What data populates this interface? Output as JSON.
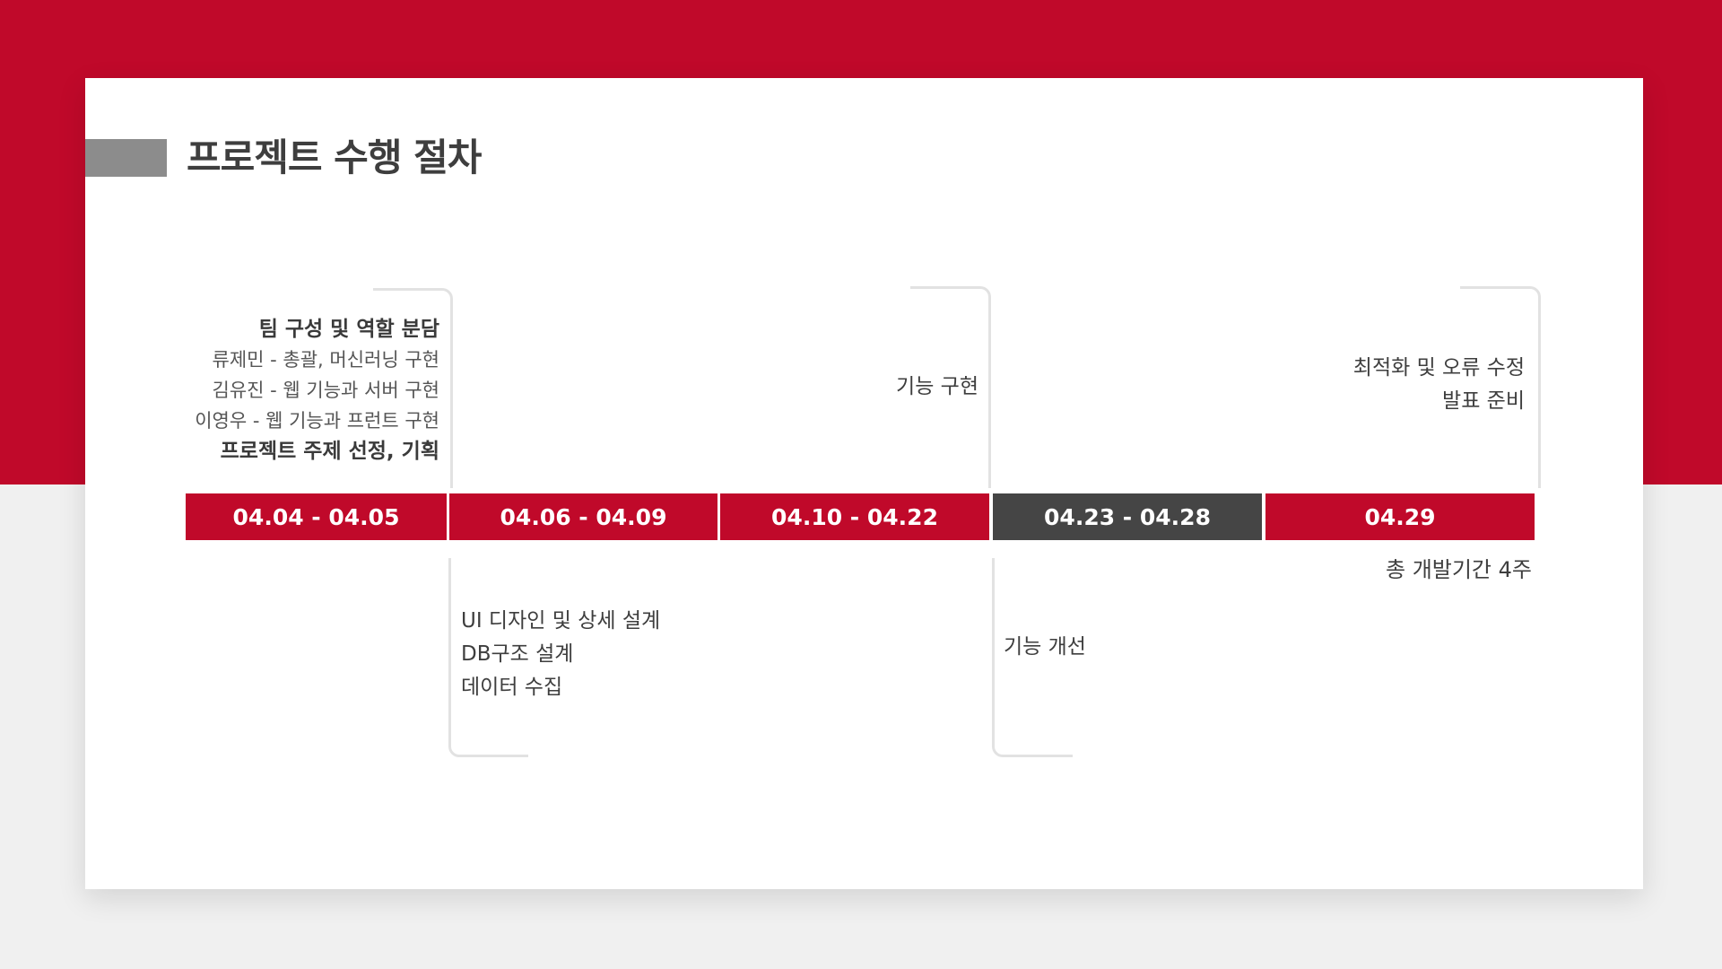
{
  "slide": {
    "title": "프로젝트 수행 절차"
  },
  "timeline": {
    "segments": [
      {
        "label": "04.04 - 04.05",
        "color": "#c0092a"
      },
      {
        "label": "04.06 - 04.09",
        "color": "#c0092a"
      },
      {
        "label": "04.10 - 04.22",
        "color": "#c0092a"
      },
      {
        "label": "04.23 - 04.28",
        "color": "#454545"
      },
      {
        "label": "04.29",
        "color": "#c0092a"
      }
    ]
  },
  "phase1": {
    "lines": [
      "팀 구성 및 역할 분담",
      "류제민 - 총괄, 머신러닝 구현",
      "김유진 - 웹 기능과 서버 구현",
      "이영우 - 웹 기능과 프런트 구현",
      "프로젝트 주제 선정, 기획"
    ]
  },
  "phase2": {
    "lines": [
      "UI 디자인 및 상세 설계",
      "DB구조 설계",
      "데이터 수집"
    ]
  },
  "phase3": {
    "lines": [
      "기능 구현"
    ]
  },
  "phase4": {
    "lines": [
      "기능 개선"
    ]
  },
  "phase5": {
    "lines": [
      "최적화 및 오류 수정",
      "발표 준비"
    ]
  },
  "footer": {
    "total": "총 개발기간 4주"
  },
  "colors": {
    "accent": "#c0092a",
    "dark": "#454545",
    "title_bar": "#8c8c8c"
  }
}
